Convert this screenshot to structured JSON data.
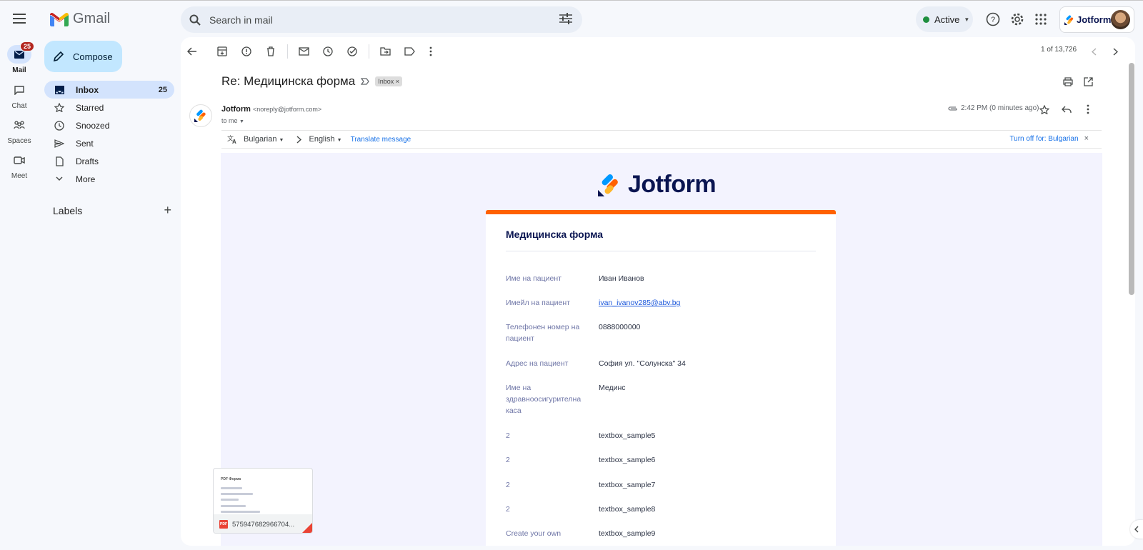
{
  "app": {
    "name": "Gmail"
  },
  "search": {
    "placeholder": "Search in mail"
  },
  "status": {
    "label": "Active",
    "color": "#1e8e3e"
  },
  "account": {
    "brand": "Jotform"
  },
  "rail": [
    {
      "label": "Mail",
      "badge": "25",
      "icon": "mail-icon"
    },
    {
      "label": "Chat",
      "icon": "chat-icon"
    },
    {
      "label": "Spaces",
      "icon": "spaces-icon"
    },
    {
      "label": "Meet",
      "icon": "meet-icon"
    }
  ],
  "compose": {
    "label": "Compose"
  },
  "nav": [
    {
      "label": "Inbox",
      "count": "25",
      "icon": "inbox-icon"
    },
    {
      "label": "Starred",
      "icon": "star-icon"
    },
    {
      "label": "Snoozed",
      "icon": "clock-icon"
    },
    {
      "label": "Sent",
      "icon": "send-icon"
    },
    {
      "label": "Drafts",
      "icon": "draft-icon"
    },
    {
      "label": "More",
      "icon": "chevron-down-icon"
    }
  ],
  "labels": {
    "title": "Labels"
  },
  "pager": {
    "text": "1 of 13,726"
  },
  "message": {
    "subject": "Re: Медицинска форма",
    "chip": "Inbox",
    "sender_name": "Jotform",
    "sender_email": "<noreply@jotform.com>",
    "to": "to me",
    "time": "2:42 PM (0 minutes ago)"
  },
  "translate": {
    "from": "Bulgarian",
    "to": "English",
    "action": "Translate message",
    "turn_off": "Turn off for: Bulgarian"
  },
  "email": {
    "logo_text": "Jotform",
    "form_title": "Медицинска форма",
    "rows": [
      {
        "label": "Име на пациент",
        "value": "Иван Иванов"
      },
      {
        "label": "Имейл на пациент",
        "value": "ivan_ivanov285@abv.bg"
      },
      {
        "label": "Телефонен номер на пациент",
        "value": "0888000000"
      },
      {
        "label": "Адрес на пациент",
        "value": "София ул. \"Солунска\" 34"
      },
      {
        "label": "Име на здравноосигурителна каса",
        "value": "Мединс"
      },
      {
        "label": "2",
        "value": "textbox_sample5"
      },
      {
        "label": "2",
        "value": "textbox_sample6"
      },
      {
        "label": "2",
        "value": "textbox_sample7"
      },
      {
        "label": "2",
        "value": "textbox_sample8"
      },
      {
        "label": "Create your own",
        "value": "textbox_sample9"
      }
    ]
  },
  "attachment": {
    "filename": "575947682966704...",
    "preview_title": "PDF Форма"
  },
  "colors": {
    "accent": "#ff6100",
    "brand_navy": "#0a1551",
    "link": "#1a73e8"
  }
}
